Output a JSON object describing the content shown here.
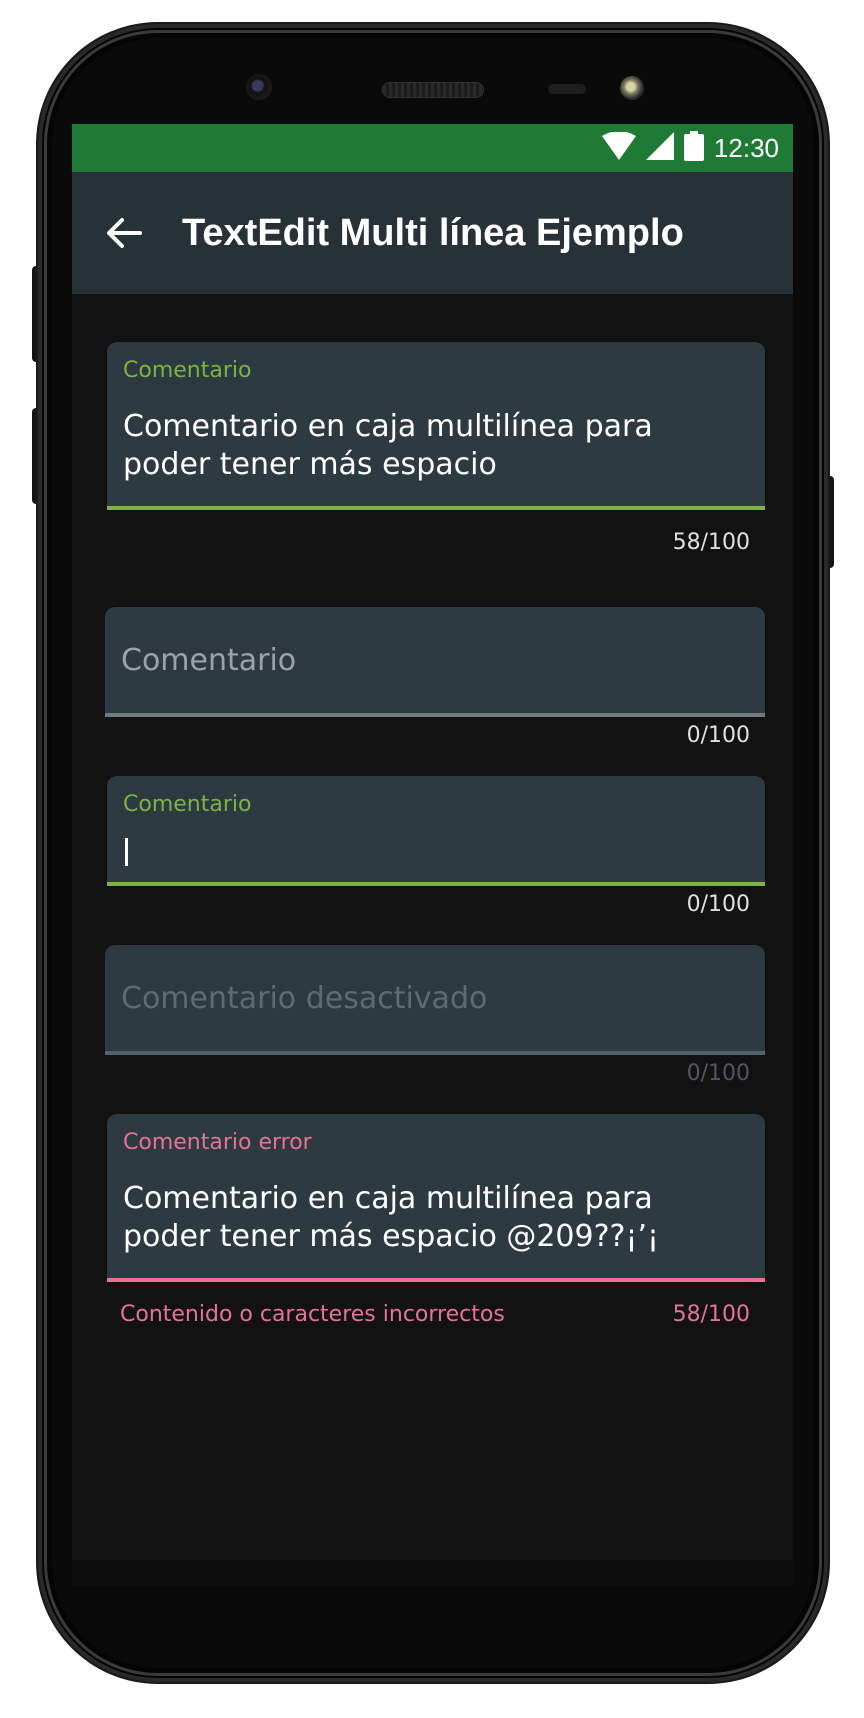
{
  "status_bar": {
    "time": "12:30",
    "icons": [
      "wifi-icon",
      "cell-signal-icon",
      "battery-icon"
    ],
    "color": "#1f7a36"
  },
  "app_bar": {
    "title": "TextEdit Multi línea Ejemplo",
    "back_icon": "arrow-left-icon",
    "color": "#263238"
  },
  "fields": [
    {
      "state": "focused-filled",
      "label": "Comentario",
      "value": "Comentario en caja multilínea para\npoder tener más espacio",
      "counter": "58/100"
    },
    {
      "state": "empty",
      "placeholder": "Comentario",
      "counter": "0/100"
    },
    {
      "state": "focused-empty",
      "label": "Comentario",
      "value": "",
      "counter": "0/100"
    },
    {
      "state": "disabled",
      "placeholder": "Comentario desactivado",
      "counter": "0/100"
    },
    {
      "state": "error",
      "label": "Comentario error",
      "value": "Comentario en caja multilínea para\npoder tener más espacio @209??¡’¡",
      "helper": "Contenido o caracteres incorrectos",
      "counter": "58/100"
    }
  ],
  "colors": {
    "accent": "#7cb342",
    "error": "#e57393",
    "field_bg": "#2e3a42",
    "background": "#121212"
  }
}
